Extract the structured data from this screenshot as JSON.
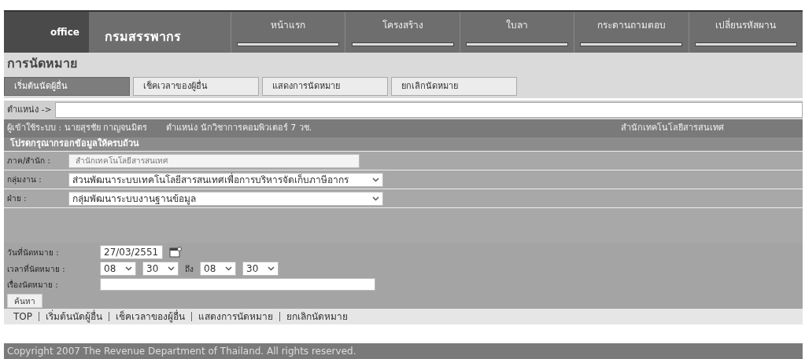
{
  "header": {
    "logo": "office",
    "site_title": "กรมสรรพากร",
    "nav": [
      {
        "label": "หน้าแรก"
      },
      {
        "label": "โครงสร้าง"
      },
      {
        "label": "ใบลา"
      },
      {
        "label": "กระดานถามตอบ"
      },
      {
        "label": "เปลี่ยนรหัสผาน"
      }
    ]
  },
  "page_title": "การนัดหมาย",
  "tabs": [
    {
      "label": "เริ่มต้นนัดผู้อื่น",
      "selected": true
    },
    {
      "label": "เช็คเวลาของผู้อื่น",
      "selected": false
    },
    {
      "label": "แสดงการนัดหมาย",
      "selected": false
    },
    {
      "label": "ยกเลิกนัดหมาย",
      "selected": false
    }
  ],
  "path": {
    "label": "ตำแหน่ง ->"
  },
  "user_bar": {
    "user": "ผู้เข้าใช้ระบบ : นายสุรชัย กาญจนมิตร",
    "position": "ตำแหน่ง นักวิชาการคอมพิวเตอร์ 7 วช.",
    "office": "สำนักเทคโนโลยีสารสนเทศ"
  },
  "form": {
    "heading": "โปรดกรุณากรอกข้อมูลให้ครบถ้วน",
    "rows": [
      {
        "label": "ภาค/สำนัก :",
        "kind": "input",
        "value": "สำนักเทคโนโลยีสารสนเทศ",
        "disabled": true
      },
      {
        "label": "กลุ่มงาน :",
        "kind": "select",
        "value": "ส่วนพัฒนาระบบเทคโนโลยีสารสนเทศเพื่อการบริหารจัดเก็บภาษีอากร"
      },
      {
        "label": "ฝ่าย :",
        "kind": "select",
        "value": "กลุ่มพัฒนาระบบงานฐานข้อมูล"
      }
    ]
  },
  "appointment": {
    "date_label": "วันที่นัดหมาย :",
    "date": "27/03/2551",
    "time_label": "เวลาที่นัดหมาย :",
    "start_hour": "08",
    "start_minute": "30",
    "to_label": "ถึง",
    "end_hour": "08",
    "end_minute": "30",
    "subject_label": "เรื่องนัดหมาย :"
  },
  "search_button": "ค้นหา",
  "footer_links": [
    "TOP",
    "เริ่มต้นนัดผู้อื่น",
    "เช็คเวลาของผู้อื่น",
    "แสดงการนัดหมาย",
    "ยกเลิกนัดหมาย"
  ],
  "copyright": "Copyright 2007 The Revenue Department of Thailand. All rights reserved."
}
